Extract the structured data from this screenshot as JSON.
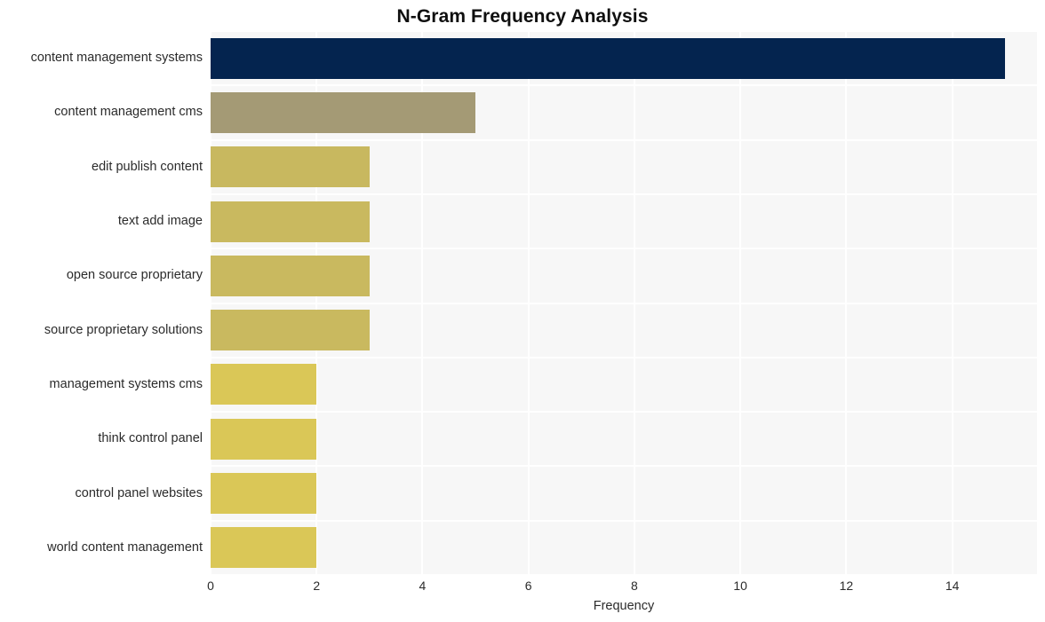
{
  "chart_data": {
    "type": "bar",
    "orientation": "horizontal",
    "title": "N-Gram Frequency Analysis",
    "xlabel": "Frequency",
    "ylabel": "",
    "xlim": [
      0,
      15.6
    ],
    "ylim": null,
    "grid": true,
    "legend": null,
    "xticks": [
      "0",
      "2",
      "4",
      "6",
      "8",
      "10",
      "12",
      "14"
    ],
    "xtick_values": [
      0,
      2,
      4,
      6,
      8,
      10,
      12,
      14
    ],
    "categories": [
      "content management systems",
      "content management cms",
      "edit publish content",
      "text add image",
      "open source proprietary",
      "source proprietary solutions",
      "management systems cms",
      "think control panel",
      "control panel websites",
      "world content management"
    ],
    "values": [
      15,
      5,
      3,
      3,
      3,
      3,
      2,
      2,
      2,
      2
    ],
    "bar_colors": [
      "#04244f",
      "#a49a75",
      "#c8b85f",
      "#c9b95f",
      "#c9b95f",
      "#c9b95f",
      "#dac757",
      "#dac757",
      "#dac757",
      "#dac757"
    ],
    "plot_background": "#f7f7f7",
    "gridline_color": "#ffffff",
    "figure_background": "#ffffff"
  }
}
